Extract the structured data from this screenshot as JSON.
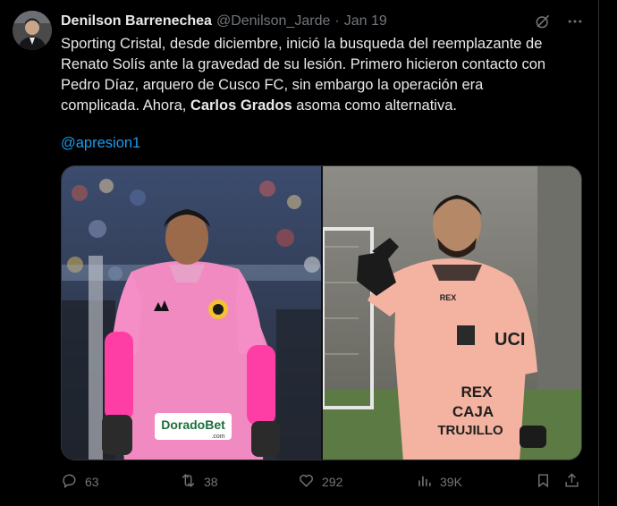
{
  "author": {
    "name": "Denilson Barrenechea",
    "handle": "@Denilson_Jarde",
    "separator": "·",
    "date": "Jan 19"
  },
  "tweet": {
    "line1": "Sporting Cristal, desde diciembre, inició la busqueda del reemplazante de",
    "line2": "Renato Solís ante la gravedad de su lesión. Primero hicieron contacto con",
    "line3": "Pedro Díaz, arquero de Cusco FC, sin embargo la operación era",
    "line4_prefix": "complicada. Ahora, ",
    "line4_bold": "Carlos Grados",
    "line4_suffix": " asoma como alternativa.",
    "mention": "@apresion1"
  },
  "media": {
    "left_sponsor": "DoradoBet",
    "left_sponsor_suffix": ".com",
    "right_shirt_text_1": "UCI",
    "right_shirt_text_2": "REX",
    "right_shirt_text_3": "CAJA",
    "right_shirt_text_4": "TRUJILLO"
  },
  "actions": {
    "replies": "63",
    "reposts": "38",
    "likes": "292",
    "views": "39K"
  },
  "icons": [
    "grok-icon",
    "more-icon",
    "reply-icon",
    "repost-icon",
    "like-icon",
    "views-icon",
    "bookmark-icon",
    "share-icon"
  ],
  "colors": {
    "background": "#000000",
    "text": "#e7e9ea",
    "muted": "#71767b",
    "link": "#1d9bf0"
  }
}
